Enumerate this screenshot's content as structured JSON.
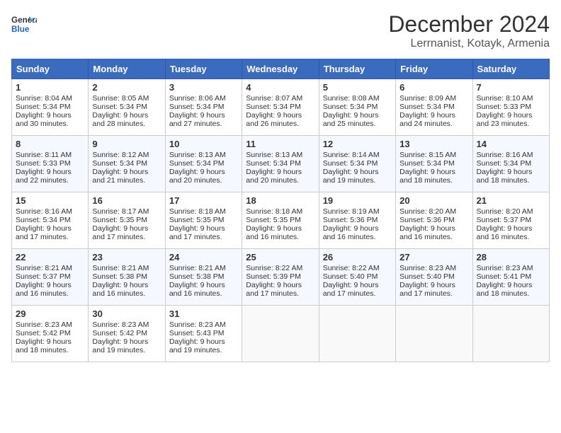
{
  "header": {
    "logo_line1": "General",
    "logo_line2": "Blue",
    "month_title": "December 2024",
    "subtitle": "Lerrnanist, Kotayk, Armenia"
  },
  "days_of_week": [
    "Sunday",
    "Monday",
    "Tuesday",
    "Wednesday",
    "Thursday",
    "Friday",
    "Saturday"
  ],
  "weeks": [
    [
      {
        "day": "1",
        "lines": [
          "Sunrise: 8:04 AM",
          "Sunset: 5:34 PM",
          "Daylight: 9 hours",
          "and 30 minutes."
        ]
      },
      {
        "day": "2",
        "lines": [
          "Sunrise: 8:05 AM",
          "Sunset: 5:34 PM",
          "Daylight: 9 hours",
          "and 28 minutes."
        ]
      },
      {
        "day": "3",
        "lines": [
          "Sunrise: 8:06 AM",
          "Sunset: 5:34 PM",
          "Daylight: 9 hours",
          "and 27 minutes."
        ]
      },
      {
        "day": "4",
        "lines": [
          "Sunrise: 8:07 AM",
          "Sunset: 5:34 PM",
          "Daylight: 9 hours",
          "and 26 minutes."
        ]
      },
      {
        "day": "5",
        "lines": [
          "Sunrise: 8:08 AM",
          "Sunset: 5:34 PM",
          "Daylight: 9 hours",
          "and 25 minutes."
        ]
      },
      {
        "day": "6",
        "lines": [
          "Sunrise: 8:09 AM",
          "Sunset: 5:34 PM",
          "Daylight: 9 hours",
          "and 24 minutes."
        ]
      },
      {
        "day": "7",
        "lines": [
          "Sunrise: 8:10 AM",
          "Sunset: 5:33 PM",
          "Daylight: 9 hours",
          "and 23 minutes."
        ]
      }
    ],
    [
      {
        "day": "8",
        "lines": [
          "Sunrise: 8:11 AM",
          "Sunset: 5:33 PM",
          "Daylight: 9 hours",
          "and 22 minutes."
        ]
      },
      {
        "day": "9",
        "lines": [
          "Sunrise: 8:12 AM",
          "Sunset: 5:34 PM",
          "Daylight: 9 hours",
          "and 21 minutes."
        ]
      },
      {
        "day": "10",
        "lines": [
          "Sunrise: 8:13 AM",
          "Sunset: 5:34 PM",
          "Daylight: 9 hours",
          "and 20 minutes."
        ]
      },
      {
        "day": "11",
        "lines": [
          "Sunrise: 8:13 AM",
          "Sunset: 5:34 PM",
          "Daylight: 9 hours",
          "and 20 minutes."
        ]
      },
      {
        "day": "12",
        "lines": [
          "Sunrise: 8:14 AM",
          "Sunset: 5:34 PM",
          "Daylight: 9 hours",
          "and 19 minutes."
        ]
      },
      {
        "day": "13",
        "lines": [
          "Sunrise: 8:15 AM",
          "Sunset: 5:34 PM",
          "Daylight: 9 hours",
          "and 18 minutes."
        ]
      },
      {
        "day": "14",
        "lines": [
          "Sunrise: 8:16 AM",
          "Sunset: 5:34 PM",
          "Daylight: 9 hours",
          "and 18 minutes."
        ]
      }
    ],
    [
      {
        "day": "15",
        "lines": [
          "Sunrise: 8:16 AM",
          "Sunset: 5:34 PM",
          "Daylight: 9 hours",
          "and 17 minutes."
        ]
      },
      {
        "day": "16",
        "lines": [
          "Sunrise: 8:17 AM",
          "Sunset: 5:35 PM",
          "Daylight: 9 hours",
          "and 17 minutes."
        ]
      },
      {
        "day": "17",
        "lines": [
          "Sunrise: 8:18 AM",
          "Sunset: 5:35 PM",
          "Daylight: 9 hours",
          "and 17 minutes."
        ]
      },
      {
        "day": "18",
        "lines": [
          "Sunrise: 8:18 AM",
          "Sunset: 5:35 PM",
          "Daylight: 9 hours",
          "and 16 minutes."
        ]
      },
      {
        "day": "19",
        "lines": [
          "Sunrise: 8:19 AM",
          "Sunset: 5:36 PM",
          "Daylight: 9 hours",
          "and 16 minutes."
        ]
      },
      {
        "day": "20",
        "lines": [
          "Sunrise: 8:20 AM",
          "Sunset: 5:36 PM",
          "Daylight: 9 hours",
          "and 16 minutes."
        ]
      },
      {
        "day": "21",
        "lines": [
          "Sunrise: 8:20 AM",
          "Sunset: 5:37 PM",
          "Daylight: 9 hours",
          "and 16 minutes."
        ]
      }
    ],
    [
      {
        "day": "22",
        "lines": [
          "Sunrise: 8:21 AM",
          "Sunset: 5:37 PM",
          "Daylight: 9 hours",
          "and 16 minutes."
        ]
      },
      {
        "day": "23",
        "lines": [
          "Sunrise: 8:21 AM",
          "Sunset: 5:38 PM",
          "Daylight: 9 hours",
          "and 16 minutes."
        ]
      },
      {
        "day": "24",
        "lines": [
          "Sunrise: 8:21 AM",
          "Sunset: 5:38 PM",
          "Daylight: 9 hours",
          "and 16 minutes."
        ]
      },
      {
        "day": "25",
        "lines": [
          "Sunrise: 8:22 AM",
          "Sunset: 5:39 PM",
          "Daylight: 9 hours",
          "and 17 minutes."
        ]
      },
      {
        "day": "26",
        "lines": [
          "Sunrise: 8:22 AM",
          "Sunset: 5:40 PM",
          "Daylight: 9 hours",
          "and 17 minutes."
        ]
      },
      {
        "day": "27",
        "lines": [
          "Sunrise: 8:23 AM",
          "Sunset: 5:40 PM",
          "Daylight: 9 hours",
          "and 17 minutes."
        ]
      },
      {
        "day": "28",
        "lines": [
          "Sunrise: 8:23 AM",
          "Sunset: 5:41 PM",
          "Daylight: 9 hours",
          "and 18 minutes."
        ]
      }
    ],
    [
      {
        "day": "29",
        "lines": [
          "Sunrise: 8:23 AM",
          "Sunset: 5:42 PM",
          "Daylight: 9 hours",
          "and 18 minutes."
        ]
      },
      {
        "day": "30",
        "lines": [
          "Sunrise: 8:23 AM",
          "Sunset: 5:42 PM",
          "Daylight: 9 hours",
          "and 19 minutes."
        ]
      },
      {
        "day": "31",
        "lines": [
          "Sunrise: 8:23 AM",
          "Sunset: 5:43 PM",
          "Daylight: 9 hours",
          "and 19 minutes."
        ]
      },
      null,
      null,
      null,
      null
    ]
  ]
}
